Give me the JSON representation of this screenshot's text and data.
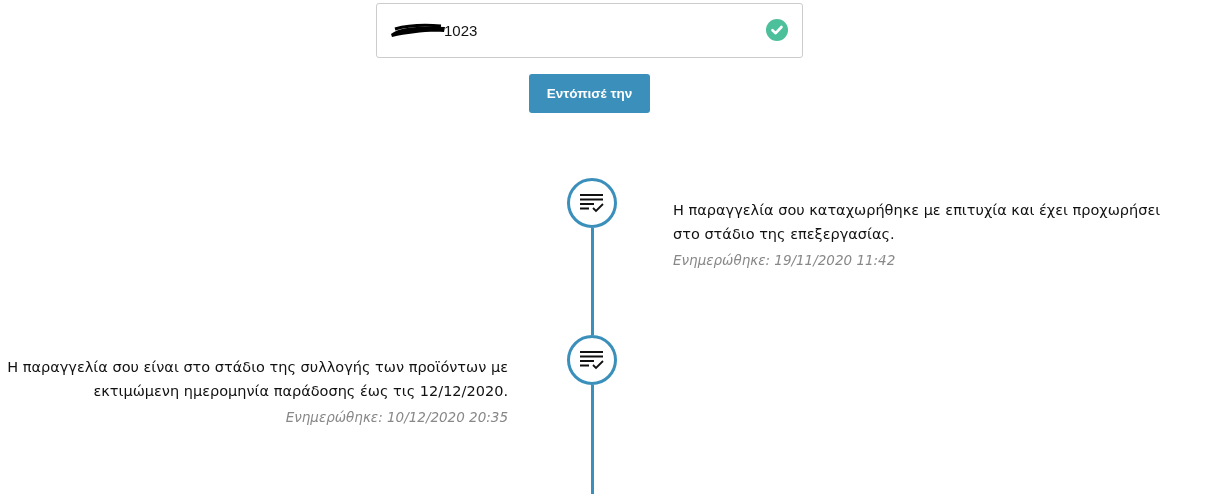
{
  "search": {
    "value": "1023",
    "redacted": true,
    "valid": true
  },
  "button": "Εντόπισέ την",
  "events": [
    {
      "kind": "right",
      "text": "Η παραγγελία σου καταχωρήθηκε με επιτυχία και έχει προχωρήσει στο στάδιο της επεξεργασίας.",
      "updated": "Ενημερώθηκε: 19/11/2020 11:42"
    },
    {
      "kind": "left",
      "text": "Η παραγγελία σου είναι στο στάδιο της συλλογής των προϊόντων με εκτιμώμενη ημερομηνία παράδοσης έως τις 12/12/2020.",
      "updated": "Ενημερώθηκε: 10/12/2020 20:35"
    }
  ]
}
